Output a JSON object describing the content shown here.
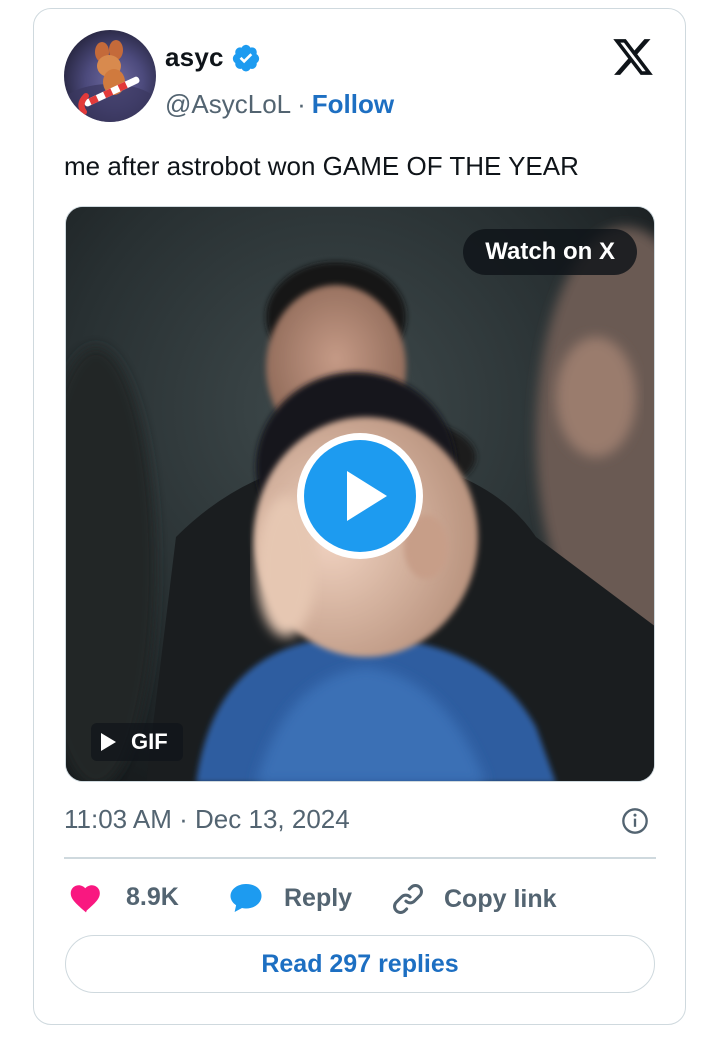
{
  "tweet": {
    "author_name": "asyc",
    "handle": "@AsycLoL",
    "separator": "·",
    "follow_label": "Follow",
    "text": "me after astrobot won GAME OF THE YEAR",
    "timestamp": "11:03 AM · Dec 13, 2024"
  },
  "media": {
    "watch_label": "Watch on X",
    "badge_label": "GIF",
    "play_icon": "play-circle-icon"
  },
  "actions": {
    "likes_label": "8.9K",
    "reply_label": "Reply",
    "copy_label": "Copy link"
  },
  "footer": {
    "read_replies_label": "Read 297 replies"
  },
  "colors": {
    "accent": "#1d9bf0",
    "link": "#1d6fc2",
    "like": "#f91880",
    "muted": "#536471",
    "border": "#cfd9de"
  }
}
